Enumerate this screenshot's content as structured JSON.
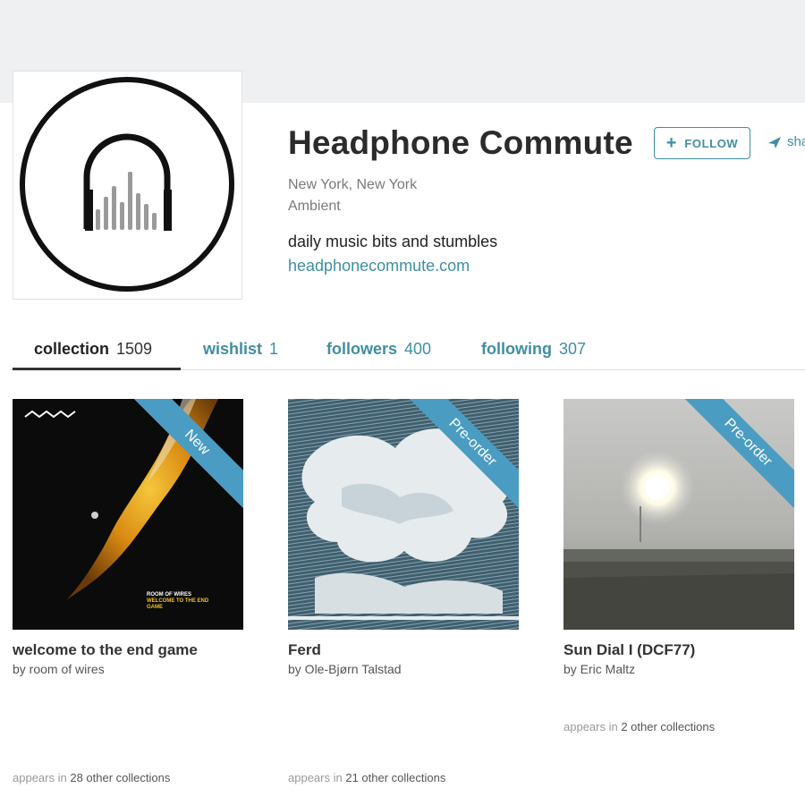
{
  "profile": {
    "name": "Headphone Commute",
    "location": "New York, New York",
    "genre": "Ambient",
    "bio": "daily music bits and stumbles",
    "website": "headphonecommute.com",
    "follow_label": "FOLLOW",
    "share_label": "sha"
  },
  "tabs": [
    {
      "label": "collection",
      "count": "1509",
      "active": true
    },
    {
      "label": "wishlist",
      "count": "1"
    },
    {
      "label": "followers",
      "count": "400"
    },
    {
      "label": "following",
      "count": "307"
    }
  ],
  "collection": [
    {
      "title": "welcome to the end game",
      "artist": "by room of wires",
      "badge": "New",
      "appears_prefix": "appears in",
      "appears_count": "28 other collections",
      "cover_text": [
        "ROOM OF WIRES",
        "WELCOME TO THE END",
        "GAME"
      ]
    },
    {
      "title": "Ferd",
      "artist": "by Ole-Bjørn Talstad",
      "badge": "Pre-order",
      "appears_prefix": "appears in",
      "appears_count": "21 other collections"
    },
    {
      "title": "Sun Dial I (DCF77)",
      "artist": "by Eric Maltz",
      "badge": "Pre-order",
      "appears_prefix": "appears in",
      "appears_count": "2 other collections"
    }
  ],
  "colors": {
    "accent": "#408ea3",
    "ribbon": "#4a9cc2",
    "header_band": "#eef0f1"
  }
}
